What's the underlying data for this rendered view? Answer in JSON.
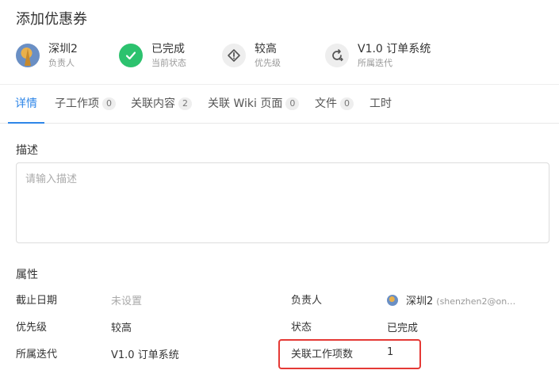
{
  "page_title": "添加优惠券",
  "meta": {
    "assignee": {
      "value": "深圳2",
      "label": "负责人"
    },
    "status": {
      "value": "已完成",
      "label": "当前状态"
    },
    "priority": {
      "value": "较高",
      "label": "优先级"
    },
    "iteration": {
      "value": "V1.0 订单系统",
      "label": "所属迭代"
    }
  },
  "tabs": [
    {
      "label": "详情",
      "count": null
    },
    {
      "label": "子工作项",
      "count": "0"
    },
    {
      "label": "关联内容",
      "count": "2"
    },
    {
      "label": "关联 Wiki 页面",
      "count": "0"
    },
    {
      "label": "文件",
      "count": "0"
    },
    {
      "label": "工时",
      "count": null
    }
  ],
  "description": {
    "label": "描述",
    "placeholder": "请输入描述"
  },
  "properties": {
    "label": "属性",
    "deadline": {
      "key": "截止日期",
      "value": "未设置"
    },
    "priority": {
      "key": "优先级",
      "value": "较高"
    },
    "iteration": {
      "key": "所属迭代",
      "value": "V1.0 订单系统"
    },
    "assignee": {
      "key": "负责人",
      "name": "深圳2",
      "email": "(shenzhen2@on…"
    },
    "status": {
      "key": "状态",
      "value": "已完成"
    },
    "linked_items": {
      "key": "关联工作项数",
      "value": "1"
    }
  },
  "colors": {
    "accent": "#2e86e8",
    "done": "#2cc26e",
    "highlight": "#e53935"
  }
}
